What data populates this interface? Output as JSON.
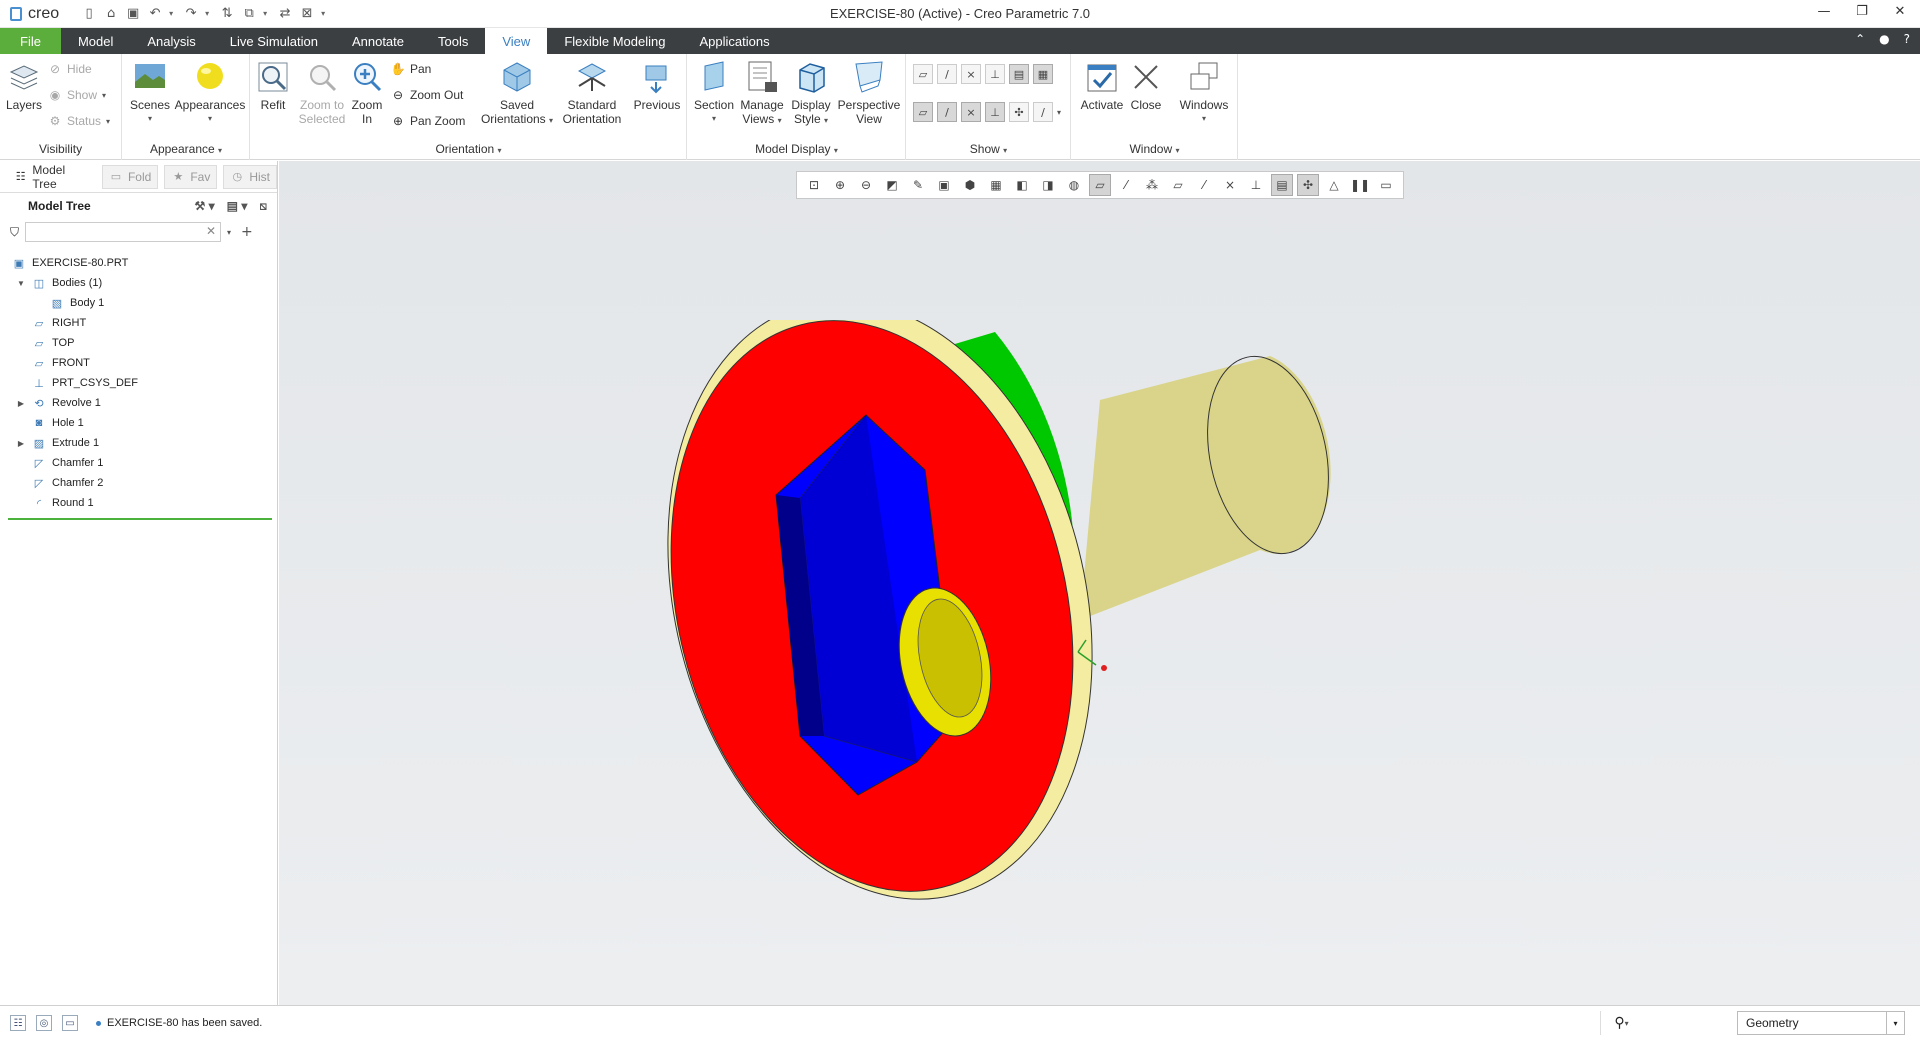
{
  "app": {
    "logo_text": "creo",
    "window_title": "EXERCISE-80 (Active) - Creo Parametric 7.0"
  },
  "menu_tabs": [
    {
      "label": "File"
    },
    {
      "label": "Model"
    },
    {
      "label": "Analysis"
    },
    {
      "label": "Live Simulation"
    },
    {
      "label": "Annotate"
    },
    {
      "label": "Tools"
    },
    {
      "label": "View"
    },
    {
      "label": "Flexible Modeling"
    },
    {
      "label": "Applications"
    }
  ],
  "active_tab": "View",
  "ribbon": {
    "visibility": {
      "group_label": "Visibility",
      "layers": "Layers",
      "hide": "Hide",
      "show": "Show",
      "status": "Status"
    },
    "appearance": {
      "group_label": "Appearance",
      "scenes": "Scenes",
      "appearances": "Appearances"
    },
    "orientation": {
      "group_label": "Orientation",
      "refit": "Refit",
      "zoom_to_selected_1": "Zoom to",
      "zoom_to_selected_2": "Selected",
      "zoom_in_1": "Zoom",
      "zoom_in_2": "In",
      "pan": "Pan",
      "zoom_out": "Zoom Out",
      "pan_zoom": "Pan Zoom",
      "saved_orientations_1": "Saved",
      "saved_orientations_2": "Orientations",
      "standard_orientation_1": "Standard",
      "standard_orientation_2": "Orientation",
      "previous": "Previous"
    },
    "model_display": {
      "group_label": "Model Display",
      "section": "Section",
      "manage_views_1": "Manage",
      "manage_views_2": "Views",
      "display_style_1": "Display",
      "display_style_2": "Style",
      "perspective_view_1": "Perspective",
      "perspective_view_2": "View"
    },
    "show": {
      "group_label": "Show"
    },
    "window": {
      "group_label": "Window",
      "activate": "Activate",
      "close": "Close",
      "windows": "Windows"
    }
  },
  "left_panel": {
    "tabs": [
      {
        "label": "Model Tree"
      },
      {
        "label": "Fold"
      },
      {
        "label": "Fav"
      },
      {
        "label": "Hist"
      }
    ],
    "header": "Model Tree",
    "search_placeholder": "",
    "tree": [
      {
        "label": "EXERCISE-80.PRT",
        "icon": "part-icon",
        "level": 0,
        "expander": ""
      },
      {
        "label": "Bodies (1)",
        "icon": "bodies-icon",
        "level": 1,
        "expander": "▼"
      },
      {
        "label": "Body 1",
        "icon": "body-icon",
        "level": 2,
        "expander": ""
      },
      {
        "label": "RIGHT",
        "icon": "datum-plane-icon",
        "level": 1,
        "expander": ""
      },
      {
        "label": "TOP",
        "icon": "datum-plane-icon",
        "level": 1,
        "expander": ""
      },
      {
        "label": "FRONT",
        "icon": "datum-plane-icon",
        "level": 1,
        "expander": ""
      },
      {
        "label": "PRT_CSYS_DEF",
        "icon": "csys-icon",
        "level": 1,
        "expander": ""
      },
      {
        "label": "Revolve 1",
        "icon": "revolve-icon",
        "level": 1,
        "expander": "▶"
      },
      {
        "label": "Hole 1",
        "icon": "hole-icon",
        "level": 1,
        "expander": ""
      },
      {
        "label": "Extrude 1",
        "icon": "extrude-icon",
        "level": 1,
        "expander": "▶"
      },
      {
        "label": "Chamfer 1",
        "icon": "chamfer-icon",
        "level": 1,
        "expander": ""
      },
      {
        "label": "Chamfer 2",
        "icon": "chamfer-icon",
        "level": 1,
        "expander": ""
      },
      {
        "label": "Round 1",
        "icon": "round-icon",
        "level": 1,
        "expander": ""
      }
    ]
  },
  "model_colors": {
    "face": "#ff0000",
    "cylinder": "#00c800",
    "socket": "#0000ff",
    "chamfer": "#f4eca0",
    "shaft": "#d9d48a",
    "bore": "#e8e000"
  },
  "status": {
    "message": "EXERCISE-80 has been saved.",
    "selection_filter": "Geometry"
  }
}
